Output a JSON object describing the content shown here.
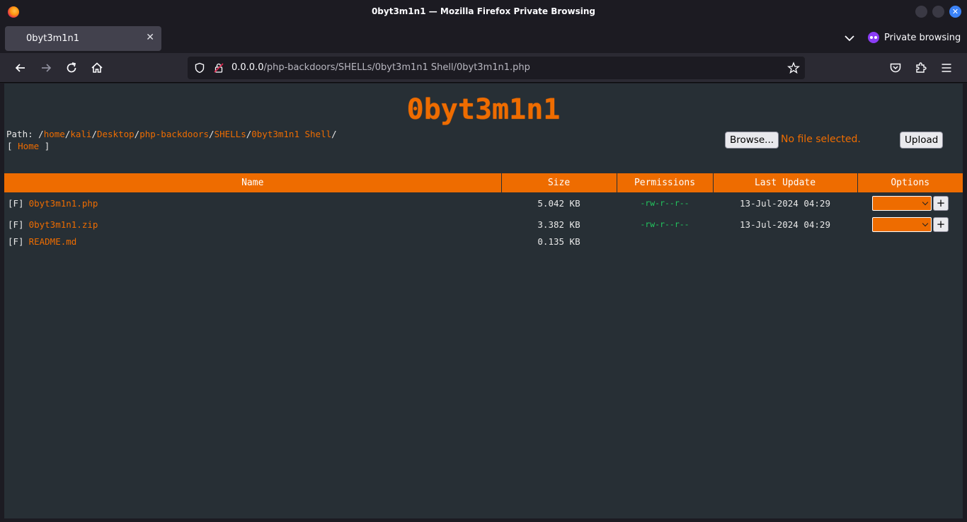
{
  "window": {
    "title": "0byt3m1n1 — Mozilla Firefox Private Browsing",
    "close_glyph": "✕"
  },
  "tab": {
    "label": "0byt3m1n1",
    "close_glyph": "✕"
  },
  "private_label": "Private browsing",
  "url": {
    "host": "0.0.0.0",
    "path": "/php-backdoors/SHELLs/0byt3m1n1 Shell/0byt3m1n1.php"
  },
  "page": {
    "logo": "0byt3m1n1",
    "path_prefix": "Path: /",
    "path_segments": [
      "home",
      "kali",
      "Desktop",
      "php-backdoors",
      "SHELLs",
      "0byt3m1n1 Shell"
    ],
    "path_sep": "/",
    "home_open": "[ ",
    "home_label": "Home",
    "home_close": " ]",
    "browse_label": "Browse...",
    "file_status": "No file selected.",
    "upload_label": "Upload"
  },
  "table": {
    "headers": [
      "Name",
      "Size",
      "Permissions",
      "Last Update",
      "Options"
    ],
    "rows": [
      {
        "type": "[F]",
        "name": "0byt3m1n1.php",
        "size": "5.042 KB",
        "perms": "-rw-r--r--",
        "date": "13-Jul-2024 04:29",
        "options": true
      },
      {
        "type": "[F]",
        "name": "0byt3m1n1.zip",
        "size": "3.382 KB",
        "perms": "-rw-r--r--",
        "date": "13-Jul-2024 04:29",
        "options": true
      },
      {
        "type": "[F]",
        "name": "README.md",
        "size": "0.135 KB",
        "perms": "",
        "date": "",
        "options": false
      }
    ],
    "plus_label": "+"
  },
  "colors": {
    "accent": "#ee6c00",
    "perm_green": "#22c55e",
    "content_bg": "#272f35"
  }
}
